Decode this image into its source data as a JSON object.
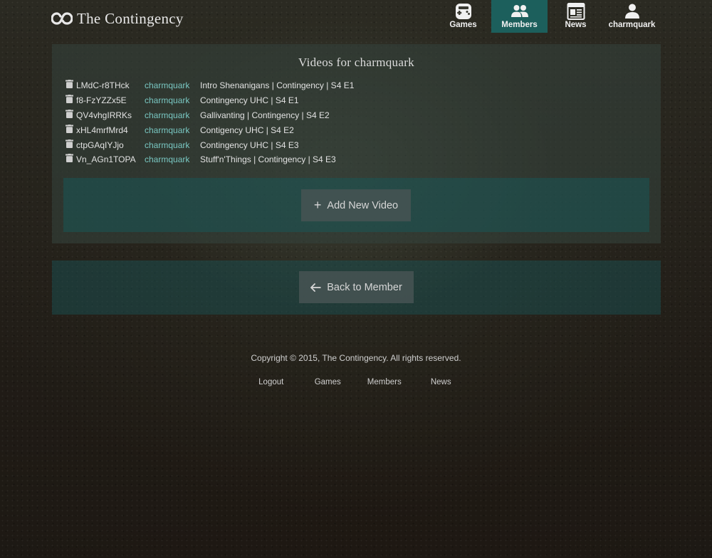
{
  "site": {
    "name": "The Contingency",
    "logo_icon": "infinity-logo-icon"
  },
  "nav": [
    {
      "label": "Games",
      "icon": "gamepad-icon",
      "active": false
    },
    {
      "label": "Members",
      "icon": "users-icon",
      "active": true
    },
    {
      "label": "News",
      "icon": "newspaper-icon",
      "active": false
    },
    {
      "label": "charmquark",
      "icon": "user-icon",
      "active": false
    }
  ],
  "videos": {
    "title": "Videos for charmquark",
    "rows": [
      {
        "id": "LMdC-r8THck",
        "user": "charmquark",
        "title": "Intro Shenanigans | Contingency | S4 E1"
      },
      {
        "id": "f8-FzYZZx5E",
        "user": "charmquark",
        "title": "Contingency UHC | S4 E1"
      },
      {
        "id": "QV4vhgIRRKs",
        "user": "charmquark",
        "title": "Gallivanting | Contingency | S4 E2"
      },
      {
        "id": "xHL4mrfMrd4",
        "user": "charmquark",
        "title": "Contigency UHC | S4 E2"
      },
      {
        "id": "ctpGAqIYJjo",
        "user": "charmquark",
        "title": "Contingency UHC | S4 E3"
      },
      {
        "id": "Vn_AGn1TOPA",
        "user": "charmquark",
        "title": "Stuff'n'Things | Contingency | S4 E3"
      }
    ],
    "add_label": "Add New Video"
  },
  "back": {
    "label": "Back to Member"
  },
  "footer": {
    "copyright": "Copyright © 2015, The Contingency. All rights reserved.",
    "links": [
      "Logout",
      "Games",
      "Members",
      "News"
    ]
  },
  "colors": {
    "accent": "#1c5f5c",
    "link": "#79c7c2"
  }
}
